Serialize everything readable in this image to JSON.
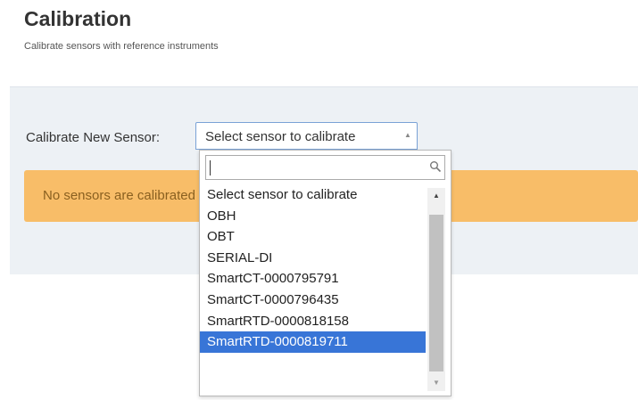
{
  "header": {
    "title": "Calibration",
    "subtitle": "Calibrate sensors with reference instruments"
  },
  "form": {
    "label": "Calibrate New Sensor:",
    "select_value": "Select sensor to calibrate"
  },
  "alert": {
    "text": "No sensors are calibrated"
  },
  "dropdown": {
    "search_value": "",
    "options": [
      "Select sensor to calibrate",
      "OBH",
      "OBT",
      "SERIAL-DI",
      "SmartCT-0000795791",
      "SmartCT-0000796435",
      "SmartRTD-0000818158",
      "SmartRTD-0000819711"
    ],
    "highlighted_option": "SmartRTD-0000819711"
  },
  "colors": {
    "alert_bg": "#f8bd68",
    "panel_bg": "#edf1f5",
    "highlight": "#3875d7"
  },
  "icons": {
    "search": "magnifier-icon",
    "select_arrow": "triangle-up-icon",
    "scroll_up": "scroll-up-arrow-icon",
    "scroll_down": "scroll-down-arrow-icon"
  }
}
